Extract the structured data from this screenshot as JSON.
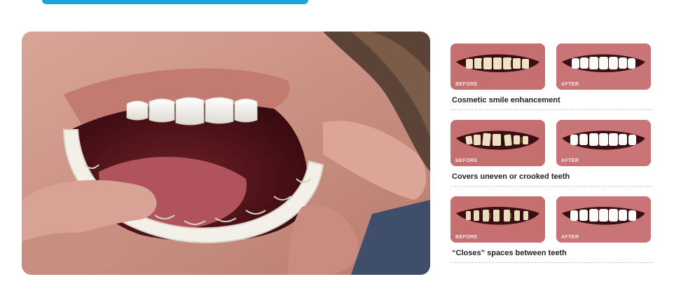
{
  "colors": {
    "accent": "#1aa6dc",
    "lip": "#c46b6d",
    "tooth": "#f6f4ef"
  },
  "comparisons": [
    {
      "before_label": "BEFORE",
      "after_label": "AFTER",
      "caption": "Cosmetic smile enhancement"
    },
    {
      "before_label": "BEFORE",
      "after_label": "AFTER",
      "caption": "Covers uneven or crooked teeth"
    },
    {
      "before_label": "BEFORE",
      "after_label": "AFTER",
      "caption": "“Closes” spaces between teeth"
    }
  ]
}
